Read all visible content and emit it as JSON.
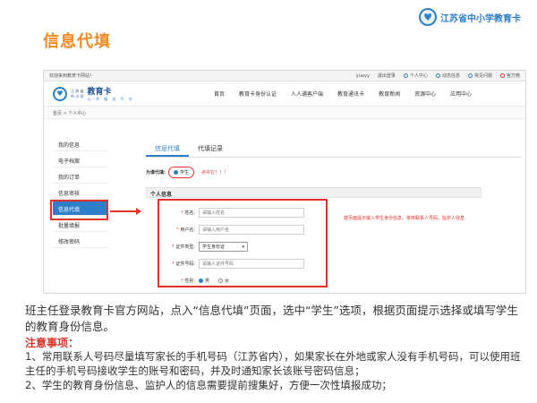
{
  "slide": {
    "title": "信息代填",
    "logo_text": "江苏省中小学教育卡"
  },
  "browser": {
    "topbar": {
      "welcome": "欢迎来到教育卡网站！",
      "user": "yueyy",
      "logout": "退出登录",
      "items": [
        "个人中心",
        "动态信息",
        "常见问题",
        "官方微"
      ]
    },
    "site": {
      "province": "江 苏 省",
      "school_level": "中 小 学",
      "name": "教育卡",
      "slogan": "公 共 服 务 平 台"
    },
    "nav": [
      "首页",
      "教育卡身份认证",
      "人人通客户端",
      "教育通讯卡",
      "教育新闻",
      "资源中心",
      "应用中心"
    ],
    "breadcrumb": "首页 > 个人中心",
    "sidebar": [
      "我的信息",
      "电子档案",
      "我的订单",
      "信息审核",
      "信息代填",
      "批量填报",
      "修改密码"
    ],
    "sidebar_active": "信息代填",
    "tabs": [
      "信息代填",
      "代填记录"
    ],
    "for_role_label": "为谁代填:",
    "for_role_option": "学生",
    "click_note": "点中它！！！",
    "section_title": "个人信息",
    "form": {
      "name_label": "姓名:",
      "name_placeholder": "请输入姓名",
      "username_label": "用户名:",
      "username_placeholder": "请输入用户名",
      "idtype_label": "证件类型:",
      "idtype_value": "学生身份证",
      "idno_label": "证件号码:",
      "idno_placeholder": "请输入证件号码",
      "gender_label": "性别:",
      "gender_options": [
        "男",
        "女"
      ]
    },
    "side_hint": "按页面提示输入学生身份信息，常用联系人号码，监护人信息"
  },
  "description": "班主任登录教育卡官方网站，点入“信息代填”页面，选中“学生”选项，根据页面提示选择或填写学生的教育身份信息。",
  "notes": {
    "title": "注意事项：",
    "items": [
      "1、常用联系人号码尽量填写家长的手机号码（江苏省内），如果家长在外地或家人没有手机号码，可以使用班主任的手机号码接收学生的账号和密码，并及时通知家长该账号密码信息；",
      "2、学生的教育身份信息、监护人的信息需要提前搜集好，方便一次性填报成功；"
    ]
  },
  "colors": {
    "accent_orange": "#f08a24",
    "brand_blue": "#2d7fc8",
    "highlight_red": "#e0322b"
  }
}
